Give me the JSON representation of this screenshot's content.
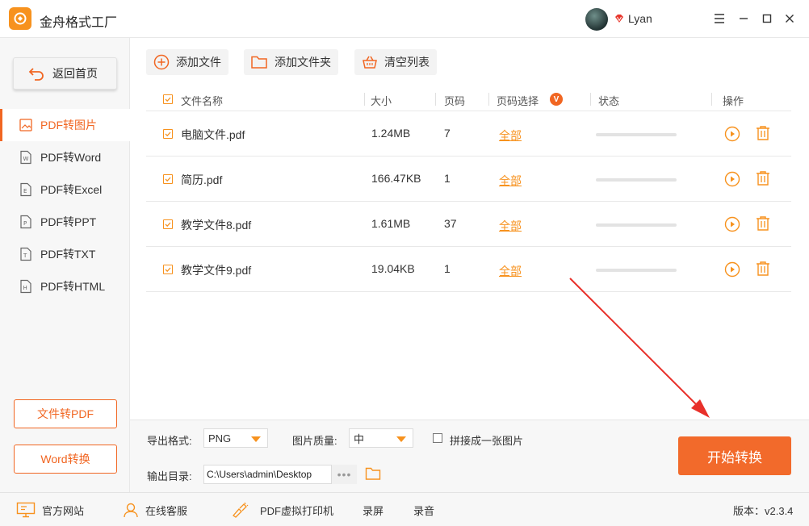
{
  "app": {
    "title": "金舟格式工厂",
    "username": "Lyan",
    "accent": "#f16622"
  },
  "sidebar": {
    "home": "返回首页",
    "items": [
      {
        "label": "PDF转图片",
        "active": true
      },
      {
        "label": "PDF转Word"
      },
      {
        "label": "PDF转Excel"
      },
      {
        "label": "PDF转PPT"
      },
      {
        "label": "PDF转TXT"
      },
      {
        "label": "PDF转HTML"
      }
    ],
    "btn_file_to_pdf": "文件转PDF",
    "btn_word_convert": "Word转换"
  },
  "toolbar": {
    "add_file": "添加文件",
    "add_folder": "添加文件夹",
    "clear_list": "清空列表"
  },
  "table": {
    "headers": {
      "name": "文件名称",
      "size": "大小",
      "pages": "页码",
      "page_select": "页码选择",
      "page_select_badge": "V",
      "status": "状态",
      "actions": "操作"
    },
    "rows": [
      {
        "name": "电脑文件.pdf",
        "size": "1.24MB",
        "pages": "7",
        "select": "全部",
        "progress": 0
      },
      {
        "name": "简历.pdf",
        "size": "166.47KB",
        "pages": "1",
        "select": "全部",
        "progress": 0
      },
      {
        "name": "教学文件8.pdf",
        "size": "1.61MB",
        "pages": "37",
        "select": "全部",
        "progress": 0
      },
      {
        "name": "教学文件9.pdf",
        "size": "19.04KB",
        "pages": "1",
        "select": "全部",
        "progress": 0
      }
    ]
  },
  "settings": {
    "format_label": "导出格式:",
    "format_value": "PNG",
    "quality_label": "图片质量:",
    "quality_value": "中",
    "merge_label": "拼接成一张图片",
    "dir_label": "输出目录:",
    "dir_value": "C:\\Users\\admin\\Desktop",
    "dots": "•••",
    "start": "开始转换"
  },
  "footer": {
    "website": "官方网站",
    "service": "在线客服",
    "printer": "PDF虚拟打印机",
    "record_screen": "录屏",
    "record_audio": "录音",
    "version": "版本：v2.3.4"
  }
}
